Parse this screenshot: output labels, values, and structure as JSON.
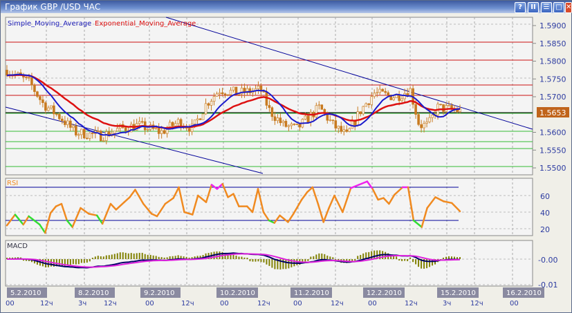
{
  "window": {
    "title": "График GBP /USD  ЧАС",
    "buttons": [
      "?",
      "II",
      "☰",
      "□",
      "✕"
    ]
  },
  "legend": {
    "sma": "Simple_Moving_Average",
    "ema": "Exponential_Moving_Average"
  },
  "price_axis": [
    "1.5900",
    "1.5850",
    "1.5800",
    "1.5750",
    "1.5700",
    "1.5600",
    "1.5550",
    "1.5500"
  ],
  "current_price": "1.5653",
  "rsi": {
    "label": "RSI",
    "ticks": [
      "60",
      "40",
      "20"
    ]
  },
  "macd": {
    "label": "MACD",
    "ticks": [
      "-0.00",
      "-0.01"
    ]
  },
  "dates": [
    "5.2.2010",
    "8.2.2010",
    "9.2.2010",
    "10.2.2010",
    "11.2.2010",
    "12.2.2010",
    "15.2.2010",
    "16.2.2010"
  ],
  "times": [
    "00",
    "12ч",
    "3ч",
    "12ч",
    "00",
    "12ч",
    "00",
    "12ч",
    "00",
    "12ч",
    "00",
    "12ч",
    "3ч",
    "12ч",
    "00"
  ],
  "colors": {
    "sma": "#1a1acc",
    "ema": "#dd1111",
    "candle": "#c87a20",
    "rsi": "#f08a20",
    "rsi_low": "#33dd33",
    "rsi_high": "#ee22ee",
    "macd": "#000066",
    "signal": "#dd22dd",
    "hist": "#808000"
  },
  "chart_data": {
    "type": "candlestick",
    "price_path": [
      [
        0,
        1.5775
      ],
      [
        5,
        1.574
      ],
      [
        8,
        1.568
      ],
      [
        12,
        1.564
      ],
      [
        15,
        1.56
      ],
      [
        21,
        1.559
      ],
      [
        25,
        1.561
      ],
      [
        29,
        1.562
      ],
      [
        34,
        1.56
      ],
      [
        38,
        1.563
      ],
      [
        41,
        1.561
      ],
      [
        44,
        1.568
      ],
      [
        47,
        1.572
      ],
      [
        51,
        1.571
      ],
      [
        56,
        1.572
      ],
      [
        58,
        1.566
      ],
      [
        61,
        1.562
      ],
      [
        64,
        1.561
      ],
      [
        69,
        1.567
      ],
      [
        72,
        1.562
      ],
      [
        75,
        1.559
      ],
      [
        78,
        1.566
      ],
      [
        81,
        1.571
      ],
      [
        86,
        1.57
      ],
      [
        89,
        1.572
      ],
      [
        91,
        1.562
      ],
      [
        93,
        1.562
      ],
      [
        95,
        1.567
      ],
      [
        100,
        1.566
      ]
    ],
    "rsi_path": [
      [
        0,
        24
      ],
      [
        3,
        37
      ],
      [
        6,
        25
      ],
      [
        8,
        35
      ],
      [
        12,
        25
      ],
      [
        14,
        15
      ],
      [
        16,
        39
      ],
      [
        18,
        47
      ],
      [
        20,
        50
      ],
      [
        22,
        30
      ],
      [
        24,
        22
      ],
      [
        27,
        45
      ],
      [
        30,
        38
      ],
      [
        33,
        36
      ],
      [
        35,
        26
      ],
      [
        38,
        50
      ],
      [
        40,
        43
      ],
      [
        43,
        52
      ],
      [
        45,
        58
      ],
      [
        47,
        67
      ],
      [
        50,
        50
      ],
      [
        53,
        38
      ],
      [
        55,
        35
      ],
      [
        58,
        50
      ],
      [
        61,
        57
      ],
      [
        63,
        70
      ],
      [
        65,
        40
      ],
      [
        68,
        37
      ],
      [
        70,
        60
      ],
      [
        73,
        52
      ],
      [
        75,
        73
      ],
      [
        77,
        68
      ],
      [
        79,
        74
      ],
      [
        81,
        58
      ],
      [
        83,
        62
      ],
      [
        85,
        47
      ],
      [
        88,
        47
      ],
      [
        90,
        40
      ],
      [
        92,
        68
      ],
      [
        94,
        40
      ],
      [
        96,
        30
      ],
      [
        98,
        27
      ],
      [
        100,
        36
      ],
      [
        103,
        28
      ],
      [
        105,
        38
      ],
      [
        108,
        55
      ],
      [
        110,
        64
      ],
      [
        112,
        70
      ],
      [
        114,
        50
      ],
      [
        116,
        28
      ],
      [
        118,
        45
      ],
      [
        120,
        60
      ],
      [
        123,
        40
      ],
      [
        126,
        69
      ],
      [
        129,
        73
      ],
      [
        132,
        77
      ],
      [
        134,
        68
      ],
      [
        136,
        55
      ],
      [
        138,
        57
      ],
      [
        140,
        50
      ],
      [
        142,
        61
      ],
      [
        145,
        70
      ],
      [
        147,
        70
      ],
      [
        149,
        30
      ],
      [
        152,
        22
      ],
      [
        154,
        45
      ],
      [
        157,
        58
      ],
      [
        160,
        53
      ],
      [
        163,
        51
      ],
      [
        166,
        41
      ]
    ],
    "rsi_levels": [
      70,
      30
    ],
    "macd_range": [
      -0.011,
      0.003
    ]
  }
}
